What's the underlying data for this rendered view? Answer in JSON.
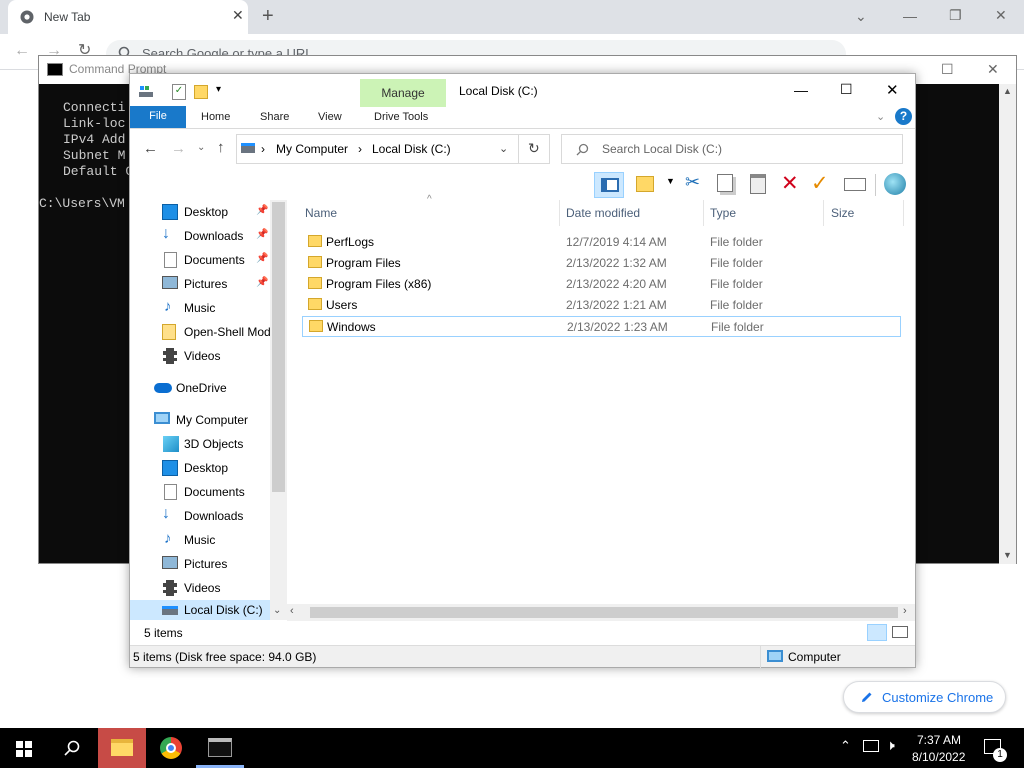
{
  "chrome": {
    "tab_title": "New Tab",
    "omnibox_placeholder": "Search Google or type a URL",
    "customize_label": "Customize Chrome"
  },
  "cmd": {
    "title": "Command Prompt",
    "lines": [
      "Connecti",
      "Link-loc",
      "IPv4 Add",
      "Subnet M",
      "Default G",
      "",
      "C:\\Users\\VM"
    ]
  },
  "explorer": {
    "title": "Local Disk (C:)",
    "manage_tab": "Manage",
    "drive_tools_tab": "Drive Tools",
    "tabs": {
      "file": "File",
      "home": "Home",
      "share": "Share",
      "view": "View"
    },
    "address": {
      "root": "My Computer",
      "current": "Local Disk (C:)"
    },
    "search_placeholder": "Search Local Disk (C:)",
    "nav": {
      "quick": [
        "Desktop",
        "Downloads",
        "Documents",
        "Pictures",
        "Music",
        "Open-Shell Mod",
        "Videos"
      ],
      "onedrive": "OneDrive",
      "computer": "My Computer",
      "computer_items": [
        "3D Objects",
        "Desktop",
        "Documents",
        "Downloads",
        "Music",
        "Pictures",
        "Videos",
        "Local Disk (C:)"
      ]
    },
    "columns": {
      "name": "Name",
      "date": "Date modified",
      "type": "Type",
      "size": "Size"
    },
    "rows": [
      {
        "name": "PerfLogs",
        "date": "12/7/2019 4:14 AM",
        "type": "File folder"
      },
      {
        "name": "Program Files",
        "date": "2/13/2022 1:32 AM",
        "type": "File folder"
      },
      {
        "name": "Program Files (x86)",
        "date": "2/13/2022 4:20 AM",
        "type": "File folder"
      },
      {
        "name": "Users",
        "date": "2/13/2022 1:21 AM",
        "type": "File folder"
      },
      {
        "name": "Windows",
        "date": "2/13/2022 1:23 AM",
        "type": "File folder"
      }
    ],
    "item_count": "5 items",
    "status": "5 items (Disk free space: 94.0 GB)",
    "status_location": "Computer"
  },
  "taskbar": {
    "time": "7:37 AM",
    "date": "8/10/2022",
    "notification_count": "1"
  },
  "colors": {
    "accent": "#1979ca",
    "manage_tab": "#ccf3b6",
    "taskbar_active": "#c74b46"
  }
}
